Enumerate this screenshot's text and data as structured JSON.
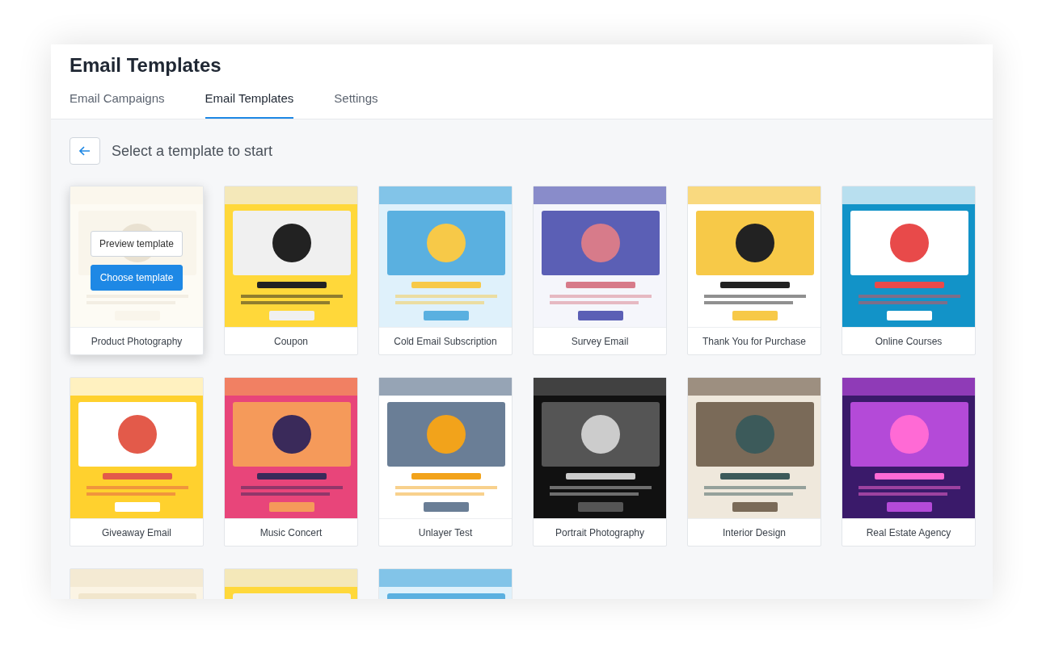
{
  "title": "Email Templates",
  "tabs": [
    {
      "label": "Email Campaigns",
      "selected": false
    },
    {
      "label": "Email Templates",
      "selected": true
    },
    {
      "label": "Settings",
      "selected": false
    }
  ],
  "heading": "Select a template to start",
  "templates": [
    {
      "name": "Product Photography",
      "hovered": true,
      "actions": [
        "Preview template",
        "Choose template"
      ]
    },
    {
      "name": "Coupon",
      "hovered": false
    },
    {
      "name": "Cold Email Subscription",
      "hovered": false
    },
    {
      "name": "Survey Email",
      "hovered": false
    },
    {
      "name": "Thank You for Purchase",
      "hovered": false
    },
    {
      "name": "Online Courses",
      "hovered": false
    },
    {
      "name": "Giveaway Email",
      "hovered": false
    },
    {
      "name": "Music Concert",
      "hovered": false
    },
    {
      "name": "Unlayer Test",
      "hovered": false
    },
    {
      "name": "Portrait Photography",
      "hovered": false
    },
    {
      "name": "Interior Design",
      "hovered": false
    },
    {
      "name": "Real Estate Agency",
      "hovered": false
    },
    {
      "hovered": false
    },
    {
      "hovered": false
    },
    {
      "hovered": false
    }
  ]
}
